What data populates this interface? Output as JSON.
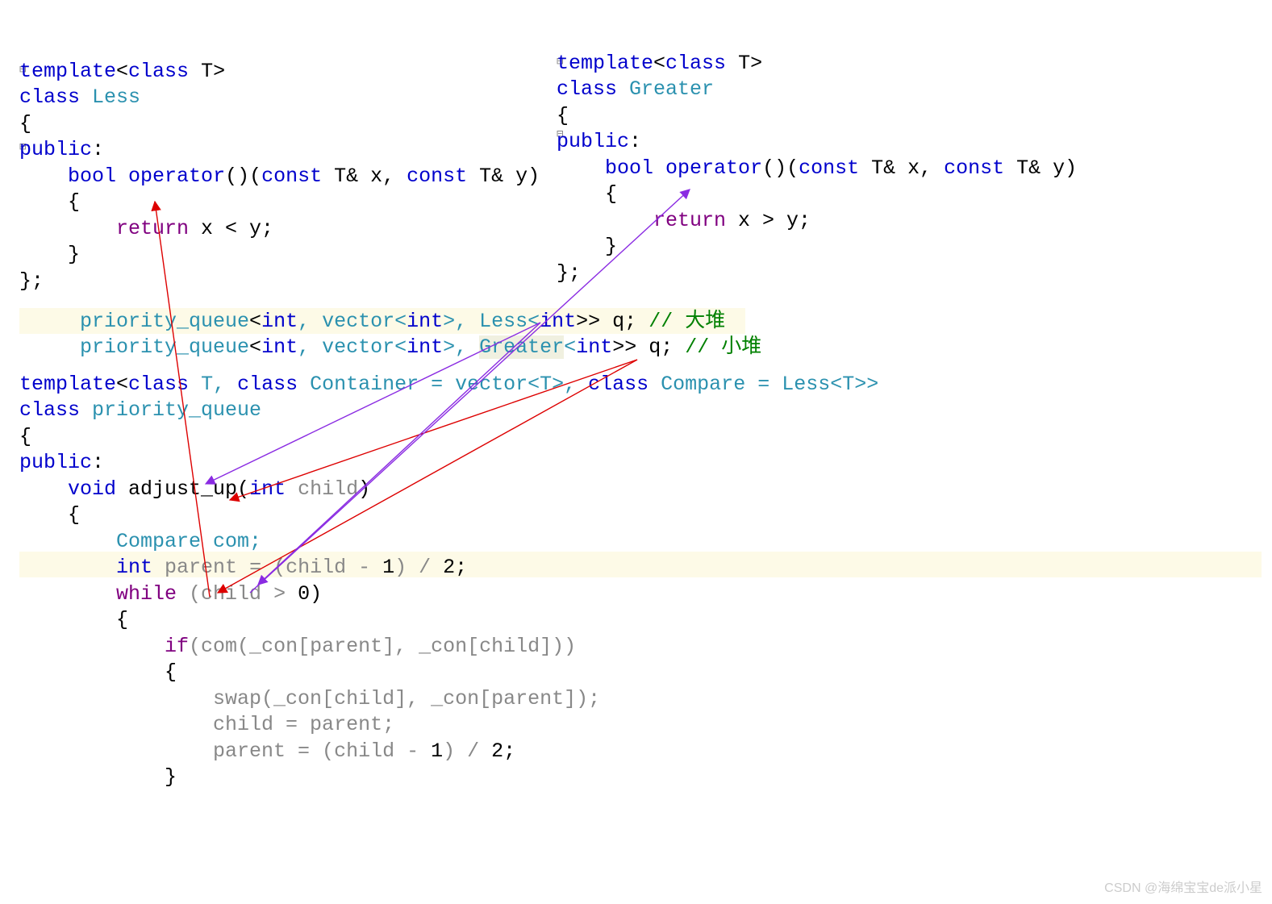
{
  "marker1": "⊟",
  "marker2": "⊟",
  "marker3": "⊟",
  "marker4": "⊟",
  "left": {
    "l1_a": "template",
    "l1_b": "<",
    "l1_c": "class",
    "l1_d": " T>",
    "l2_a": "class",
    "l2_b": " Less",
    "l3": "{",
    "l4_a": "public",
    "l4_b": ":",
    "l5_a": "    ",
    "l5_b": "bool",
    "l5_c": " ",
    "l5_d": "operator",
    "l5_e": "()(",
    "l5_f": "const",
    "l5_g": " T& x, ",
    "l5_h": "const",
    "l5_i": " T& y)",
    "l6": "    {",
    "l7_a": "        ",
    "l7_b": "return",
    "l7_c": " x < y;",
    "l8": "    }",
    "l9": "};"
  },
  "right": {
    "l1_a": "template",
    "l1_b": "<",
    "l1_c": "class",
    "l1_d": " T>",
    "l2_a": "class",
    "l2_b": " Greater",
    "l3": "{",
    "l4_a": "public",
    "l4_b": ":",
    "l5_a": "    ",
    "l5_b": "bool",
    "l5_c": " ",
    "l5_d": "operator",
    "l5_e": "()(",
    "l5_f": "const",
    "l5_g": " T& x, ",
    "l5_h": "const",
    "l5_i": " T& y)",
    "l6": "    {",
    "l7_a": "        ",
    "l7_b": "return",
    "l7_c": " x > y;",
    "l8": "    }",
    "l9": "};"
  },
  "mid": {
    "l1_a": "     priority_queue",
    "l1_b": "<",
    "l1_c": "int",
    "l1_d": ", vector<",
    "l1_e": "int",
    "l1_f": ">, Less<",
    "l1_g": "int",
    "l1_h": ">> q; ",
    "l1_i": "// 大堆",
    "l2_a": "     priority_queue",
    "l2_b": "<",
    "l2_c": "int",
    "l2_d": ", vector<",
    "l2_e": "int",
    "l2_f": ">, ",
    "l2_g": "Greater",
    "l2_h": "<",
    "l2_i": "int",
    "l2_j": ">> q; ",
    "l2_k": "// 小堆"
  },
  "bottom": {
    "l1_a": "template",
    "l1_b": "<",
    "l1_c": "class",
    "l1_d": " T, ",
    "l1_e": "class",
    "l1_f": " Container = vector<T>, ",
    "l1_g": "class",
    "l1_h": " Compare = Less<T>>",
    "l2_a": "class",
    "l2_b": " priority_queue",
    "l3": "{",
    "l4_a": "public",
    "l4_b": ":",
    "l5_a": "    ",
    "l5_b": "void",
    "l5_c": " adjust_up(",
    "l5_d": "int",
    "l5_e": " ",
    "l5_f": "child",
    "l5_g": ")",
    "l6": "    {",
    "l7_a": "        Compare com;",
    "l8_a": "        ",
    "l8_b": "int",
    "l8_c": " parent = (child - ",
    "l8_d": "1",
    "l8_e": ") / ",
    "l8_f": "2",
    "l8_g": ";",
    "l9_a": "        ",
    "l9_b": "while",
    "l9_c": " (child > ",
    "l9_d": "0",
    "l9_e": ")",
    "l10": "        {",
    "l11_a": "            ",
    "l11_b": "if",
    "l11_c": "(com(_con[parent], _con[child]))",
    "l12": "            {",
    "l13_a": "                swap(_con[child], _con[parent]);",
    "l14_a": "                child = parent;",
    "l15_a": "                parent = (child - ",
    "l15_b": "1",
    "l15_c": ") / ",
    "l15_d": "2",
    "l15_e": ";",
    "l16": "            }"
  },
  "watermark": "CSDN @海绵宝宝de派小星"
}
